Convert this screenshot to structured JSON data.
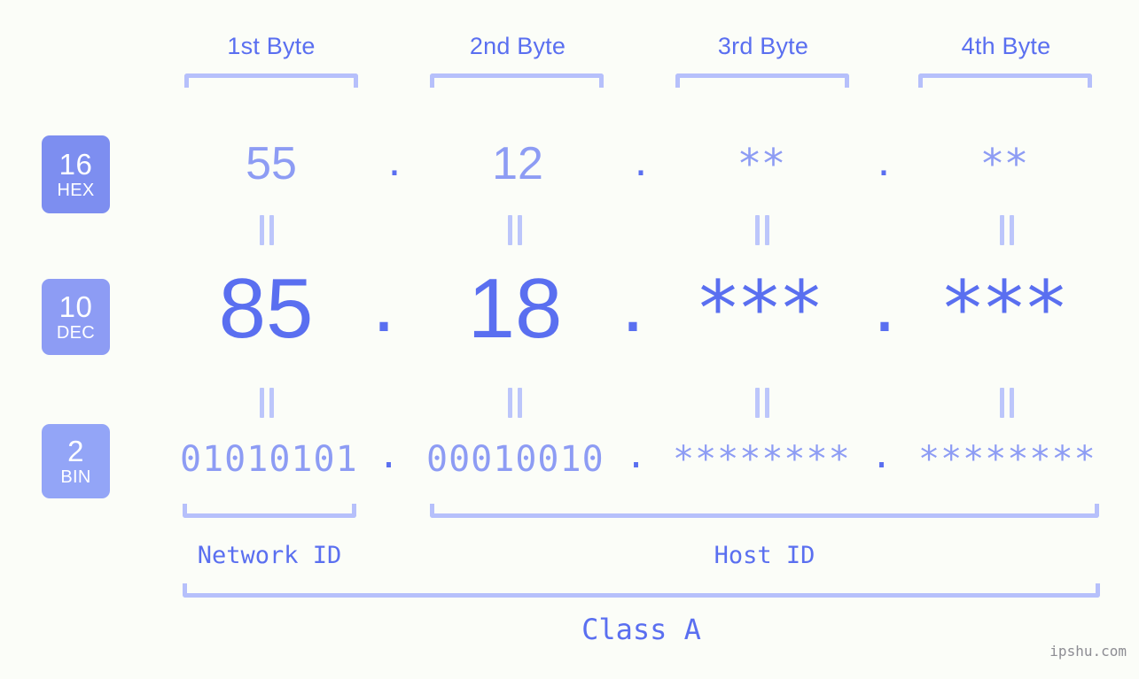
{
  "meta": {
    "background": "#fbfdf8",
    "accent_strong": "#5a6ff0",
    "accent_mid": "#8d9cf4",
    "accent_light": "#b6c0fb"
  },
  "byte_headers": [
    {
      "label": "1st Byte"
    },
    {
      "label": "2nd Byte"
    },
    {
      "label": "3rd Byte"
    },
    {
      "label": "4th Byte"
    }
  ],
  "radix_badges": [
    {
      "number": "16",
      "word": "HEX",
      "color": "#7d8ef0"
    },
    {
      "number": "10",
      "word": "DEC",
      "color": "#8d9cf4"
    },
    {
      "number": "2",
      "word": "BIN",
      "color": "#93a5f7"
    }
  ],
  "separator": ".",
  "equals_symbol": "=",
  "rows": {
    "hex": {
      "values": [
        "55",
        "12",
        "**",
        "**"
      ]
    },
    "dec": {
      "values": [
        "85",
        "18",
        "***",
        "***"
      ]
    },
    "bin": {
      "values": [
        "01010101",
        "00010010",
        "********",
        "********"
      ]
    }
  },
  "segments": {
    "network_id": "Network ID",
    "host_id": "Host ID"
  },
  "class_label": "Class A",
  "watermark": "ipshu.com"
}
